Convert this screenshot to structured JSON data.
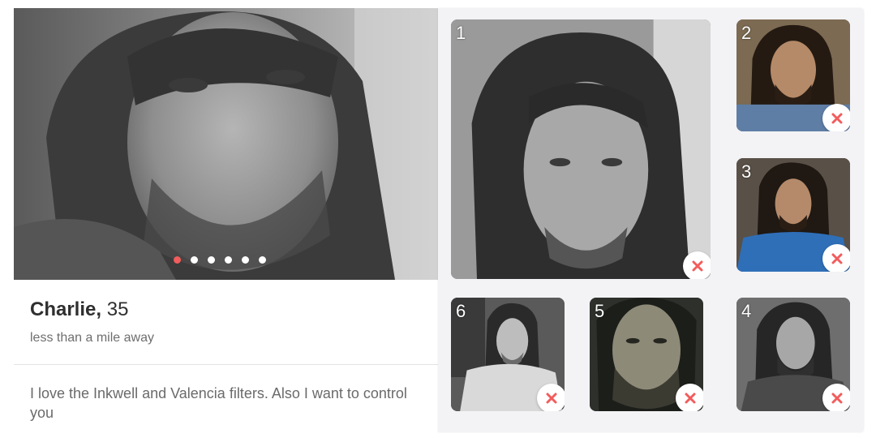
{
  "profile": {
    "name": "Charlie",
    "comma": ",",
    "age": "35",
    "distance": "less than a mile away",
    "bio": "I love the Inkwell and Valencia filters. Also I want to control you",
    "photo_dots_total": 6,
    "photo_dots_active_index": 0,
    "accent_color": "#f25c5c"
  },
  "editor": {
    "slots": [
      {
        "number": "1",
        "tone": "grayscale"
      },
      {
        "number": "2",
        "tone": "color"
      },
      {
        "number": "3",
        "tone": "color"
      },
      {
        "number": "4",
        "tone": "grayscale"
      },
      {
        "number": "5",
        "tone": "color"
      },
      {
        "number": "6",
        "tone": "grayscale"
      }
    ],
    "remove_icon": "close-icon",
    "remove_icon_color": "#f25c5c"
  }
}
